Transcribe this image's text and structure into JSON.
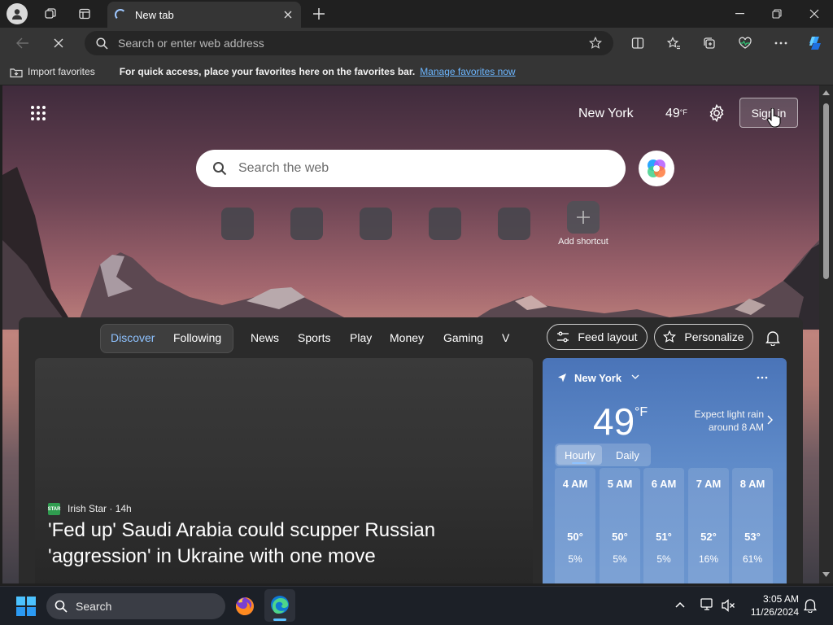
{
  "browser": {
    "tab": {
      "title": "New tab"
    },
    "address_bar": {
      "placeholder": "Search or enter web address"
    },
    "favorites_bar": {
      "import_label": "Import favorites",
      "message": "For quick access, place your favorites here on the favorites bar.",
      "manage_link": "Manage favorites now"
    }
  },
  "newtab": {
    "location": "New York",
    "temperature": "49",
    "temp_unit": "°F",
    "sign_in_label": "Sign in",
    "search_placeholder": "Search the web",
    "add_shortcut_label": "Add shortcut",
    "shortcut_count": 5
  },
  "feed": {
    "tabs": [
      "Discover",
      "Following"
    ],
    "nav": [
      "News",
      "Sports",
      "Play",
      "Money",
      "Gaming",
      "V"
    ],
    "feed_layout_label": "Feed layout",
    "personalize_label": "Personalize",
    "article": {
      "source": "Irish Star",
      "age": "· 14h",
      "headline": "'Fed up' Saudi Arabia could scupper Russian 'aggression' in Ukraine with one move"
    }
  },
  "weather": {
    "location": "New York",
    "temp": "49",
    "unit": "°F",
    "summary_line1": "Expect light rain",
    "summary_line2": "around 8 AM",
    "tabs": [
      "Hourly",
      "Daily"
    ],
    "hours": [
      {
        "time": "4 AM",
        "temp": "50°",
        "precip": "5%"
      },
      {
        "time": "5 AM",
        "temp": "50°",
        "precip": "5%"
      },
      {
        "time": "6 AM",
        "temp": "51°",
        "precip": "5%"
      },
      {
        "time": "7 AM",
        "temp": "52°",
        "precip": "16%"
      },
      {
        "time": "8 AM",
        "temp": "53°",
        "precip": "61%"
      }
    ]
  },
  "taskbar": {
    "search_label": "Search",
    "time": "3:05 AM",
    "date": "11/26/2024"
  },
  "colors": {
    "accent": "#6cb6ff",
    "discover_tab": "#8ec2ff"
  }
}
